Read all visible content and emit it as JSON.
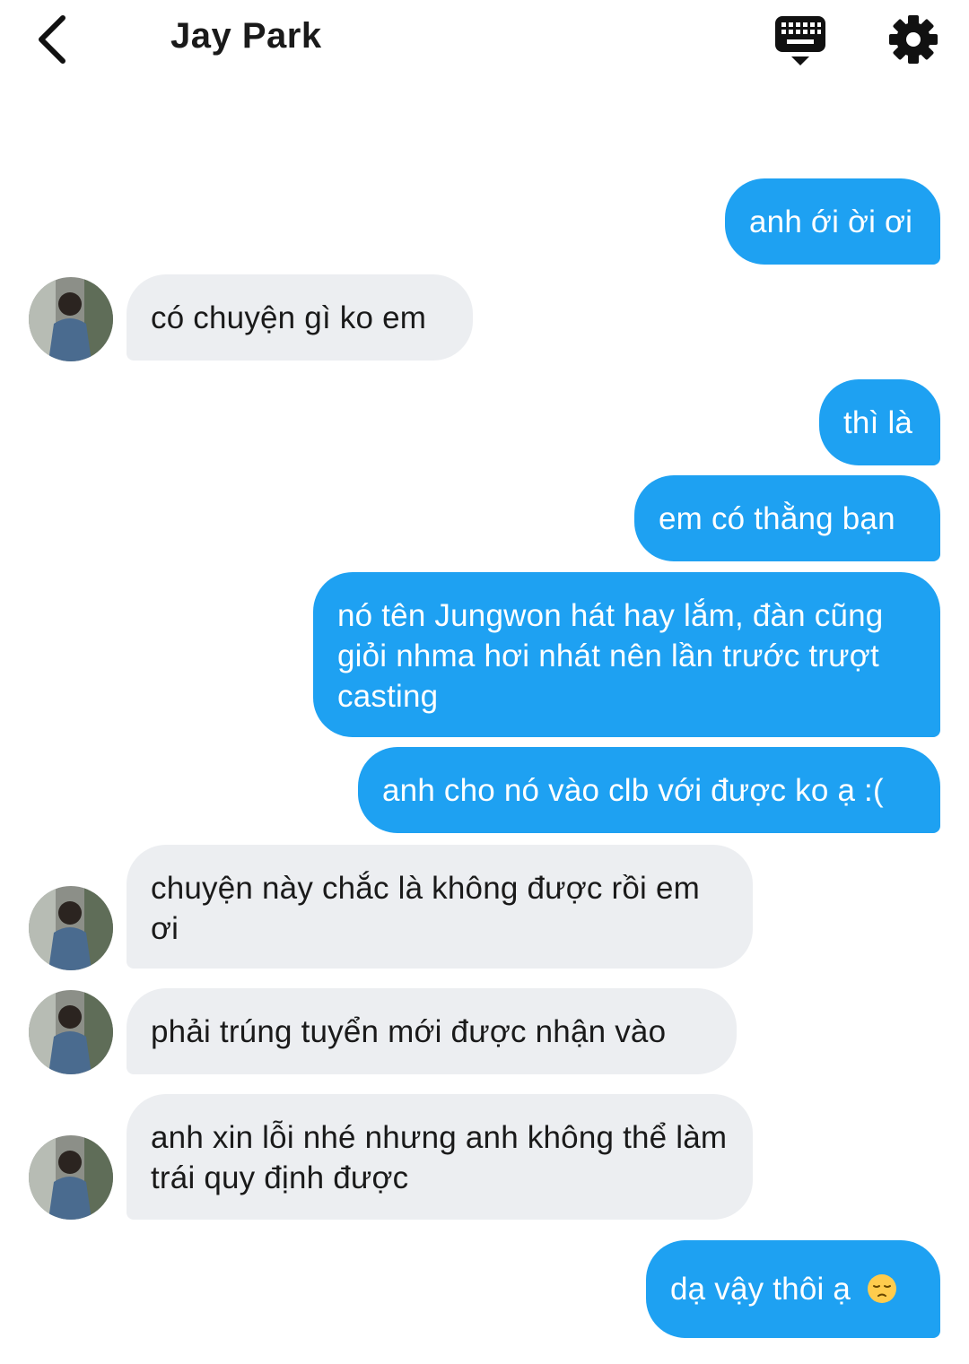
{
  "header": {
    "title": "Jay Park"
  },
  "messages": [
    {
      "from": "me",
      "text": "anh ới ời ơi"
    },
    {
      "from": "them",
      "text": "có chuyện gì ko em"
    },
    {
      "from": "me",
      "text": "thì là"
    },
    {
      "from": "me",
      "text": "em có thằng bạn"
    },
    {
      "from": "me",
      "text": "nó tên Jungwon hát hay lắm, đàn cũng giỏi nhma hơi nhát nên lần trước trượt casting"
    },
    {
      "from": "me",
      "text": "anh cho nó vào clb với được ko ạ :("
    },
    {
      "from": "them",
      "text": "chuyện này chắc là không được rồi em ơi"
    },
    {
      "from": "them",
      "text": "phải trúng tuyển mới được nhận vào"
    },
    {
      "from": "them",
      "text": "anh xin lỗi nhé nhưng anh không thể làm trái quy định được"
    },
    {
      "from": "me",
      "text": "dạ vậy thôi ạ",
      "emoji": "pensive-face-emoji"
    }
  ],
  "colors": {
    "outgoing_bubble": "#1ea1f2",
    "incoming_bubble": "#eceef1"
  }
}
